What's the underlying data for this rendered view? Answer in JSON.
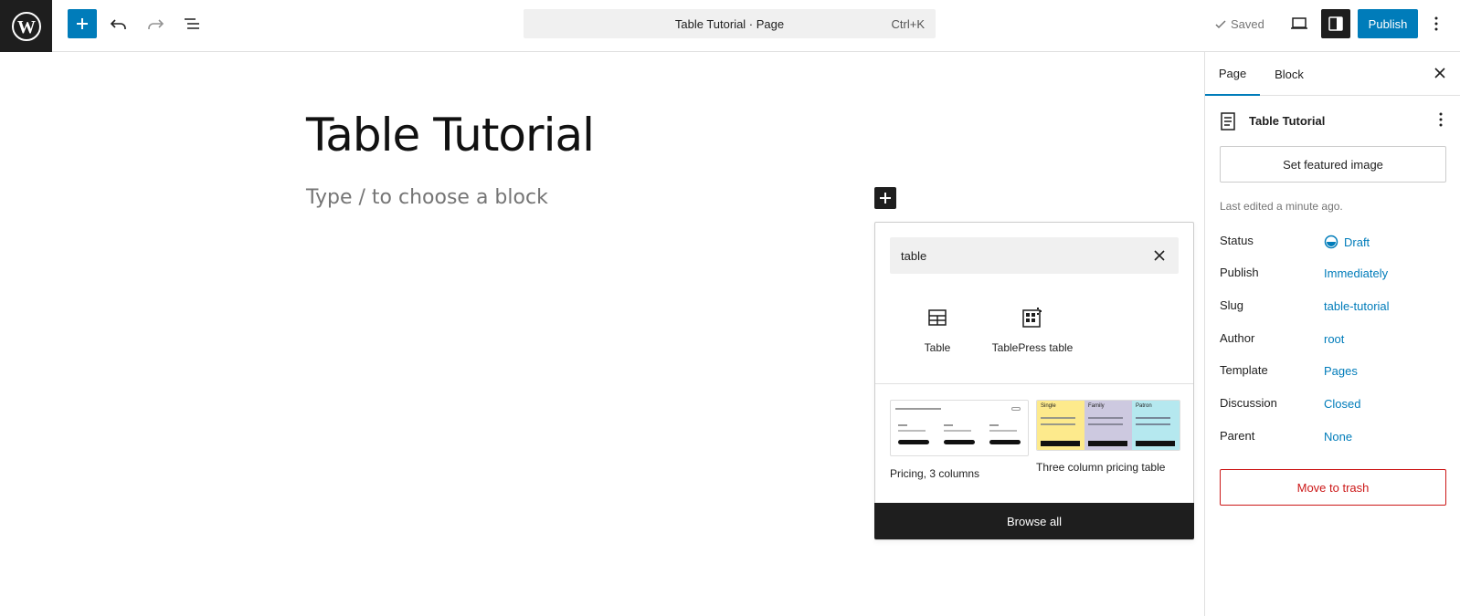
{
  "header": {
    "document_title": "Table Tutorial · Page",
    "shortcut": "Ctrl+K",
    "saved_label": "Saved",
    "publish_label": "Publish"
  },
  "editor": {
    "post_title": "Table Tutorial",
    "placeholder": "Type / to choose a block"
  },
  "inserter": {
    "search_value": "table",
    "blocks": [
      {
        "label": "Table",
        "icon": "table-icon"
      },
      {
        "label": "TablePress table",
        "icon": "tablepress-icon"
      }
    ],
    "patterns": [
      {
        "label": "Pricing, 3 columns"
      },
      {
        "label": "Three column pricing table",
        "columns": [
          "Single",
          "Family",
          "Patron"
        ]
      }
    ],
    "browse_all_label": "Browse all"
  },
  "sidebar": {
    "tabs": [
      "Page",
      "Block"
    ],
    "active_tab": "Page",
    "doc_title": "Table Tutorial",
    "featured_image_label": "Set featured image",
    "last_edited": "Last edited a minute ago.",
    "rows": [
      {
        "key": "Status",
        "value": "Draft"
      },
      {
        "key": "Publish",
        "value": "Immediately"
      },
      {
        "key": "Slug",
        "value": "table-tutorial"
      },
      {
        "key": "Author",
        "value": "root"
      },
      {
        "key": "Template",
        "value": "Pages"
      },
      {
        "key": "Discussion",
        "value": "Closed"
      },
      {
        "key": "Parent",
        "value": "None"
      }
    ],
    "trash_label": "Move to trash"
  },
  "colors": {
    "accent": "#007cba",
    "dark": "#1e1e1e",
    "danger": "#cc1818",
    "pattern_yellow": "#fdea8c",
    "pattern_purple": "#cdc9e0",
    "pattern_cyan": "#b5e8ef"
  }
}
